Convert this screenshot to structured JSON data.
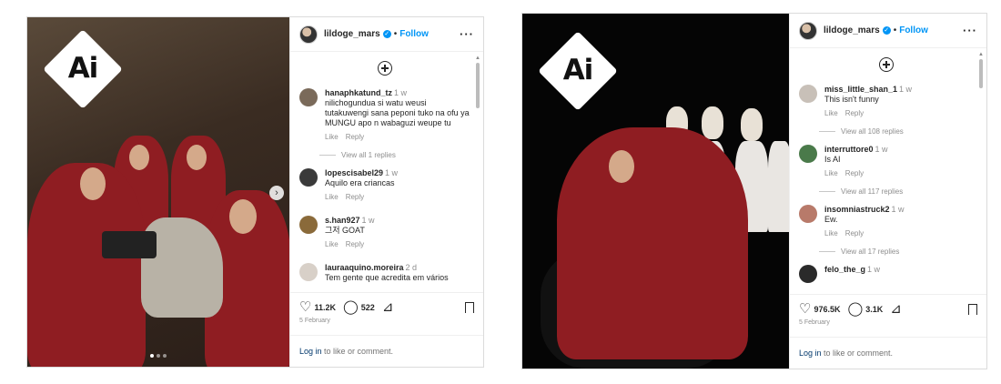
{
  "left_post": {
    "username": "lildoge_mars",
    "follow_label": "Follow",
    "ai_label": "Ai",
    "comments": [
      {
        "user": "hanaphkatund_tz",
        "time": "1 w",
        "text": "nilichogundua si watu weusi tutakuwengi sana peponi tuko na ofu ya MUNGU apo n wabaguzi weupe tu",
        "replies": "View all 1 replies"
      },
      {
        "user": "lopescisabel29",
        "time": "1 w",
        "text": "Aquilo era criancas",
        "replies": ""
      },
      {
        "user": "s.han927",
        "time": "1 w",
        "text": "그저 GOAT",
        "replies": ""
      },
      {
        "user": "lauraaquino.moreira",
        "time": "2 d",
        "text": "Tem gente que acredita em vários",
        "replies": ""
      }
    ],
    "like_label": "Like",
    "reply_label": "Reply",
    "likes": "11.2K",
    "comment_count": "522",
    "date": "5 February",
    "login_link": "Log in",
    "login_suffix": " to like or comment."
  },
  "right_post": {
    "username": "lildoge_mars",
    "follow_label": "Follow",
    "ai_label": "Ai",
    "comments": [
      {
        "user": "miss_little_shan_1",
        "time": "1 w",
        "text": "This isn't funny",
        "replies": "View all 108 replies"
      },
      {
        "user": "interruttore0",
        "time": "1 w",
        "text": "Is AI",
        "replies": "View all 117 replies"
      },
      {
        "user": "insomniastruck2",
        "time": "1 w",
        "text": "Ew.",
        "replies": "View all 17 replies"
      },
      {
        "user": "felo_the_g",
        "time": "1 w",
        "text": "",
        "replies": ""
      }
    ],
    "like_label": "Like",
    "reply_label": "Reply",
    "likes": "976.5K",
    "comment_count": "3.1K",
    "date": "5 February",
    "login_link": "Log in",
    "login_suffix": " to like or comment."
  }
}
